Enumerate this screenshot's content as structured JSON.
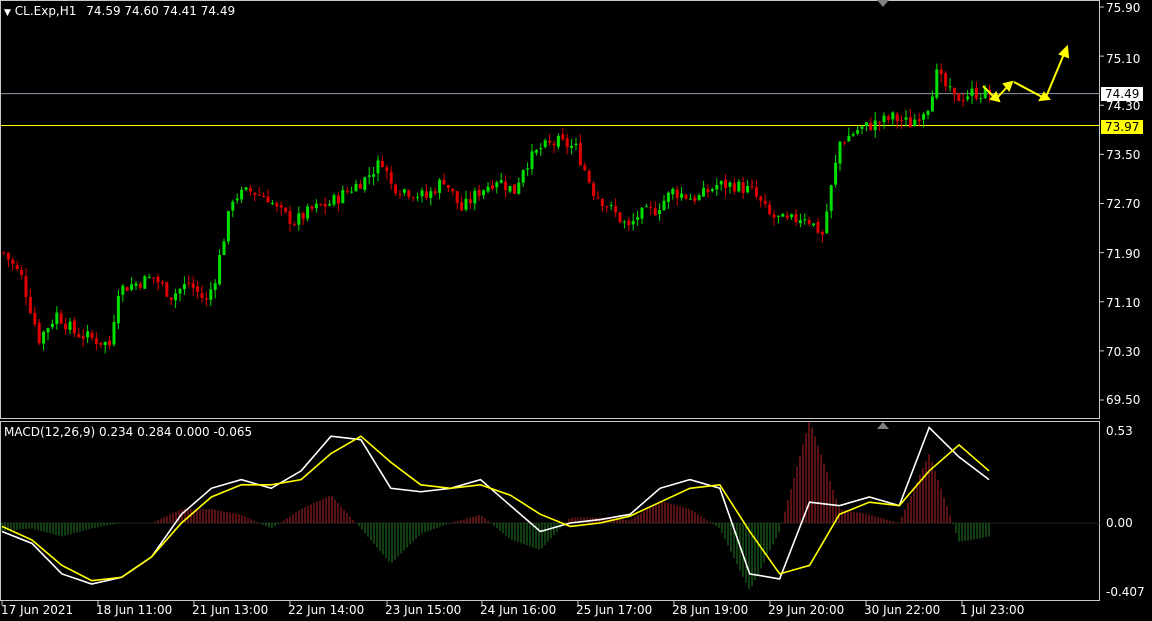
{
  "header": {
    "arrow_glyph": "▼",
    "symbol_timeframe": "CL.Exp,H1",
    "ohlc": "74.59 74.60 74.41 74.49"
  },
  "price_axis": {
    "ticks": [
      "75.90",
      "75.10",
      "74.30",
      "73.50",
      "72.70",
      "71.90",
      "71.10",
      "70.30",
      "69.50"
    ],
    "bid_label": "74.49",
    "level_label": "73.97"
  },
  "macd_panel": {
    "title": "MACD(12,26,9) 0.234 0.284 0.000 -0.065",
    "ticks": [
      "0.53",
      "0.00",
      "-0.407"
    ]
  },
  "time_axis": {
    "labels": [
      "17 Jun 2021",
      "18 Jun 11:00",
      "21 Jun 13:00",
      "22 Jun 14:00",
      "23 Jun 15:00",
      "24 Jun 16:00",
      "25 Jun 17:00",
      "28 Jun 19:00",
      "29 Jun 20:00",
      "30 Jun 22:00",
      "1 Jul 23:00"
    ]
  },
  "colors": {
    "background": "#000000",
    "bull_candle": "#00e000",
    "bear_candle": "#e00000",
    "horizontal_level": "#ffff00",
    "bid_line": "#8a9aa8",
    "macd_line": "#ffffff",
    "signal_line": "#ffff00",
    "histogram_up": "#b22222",
    "histogram_down": "#1e7d1e",
    "arrows": "#ffff00"
  },
  "chart_data": [
    {
      "type": "candlestick",
      "title": "CL.Exp,H1",
      "ylim": [
        69.3,
        75.95
      ],
      "x_labels": [
        "17 Jun 2021",
        "18 Jun 11:00",
        "21 Jun 13:00",
        "22 Jun 14:00",
        "23 Jun 15:00",
        "24 Jun 16:00",
        "25 Jun 17:00",
        "28 Jun 19:00",
        "29 Jun 20:00",
        "30 Jun 22:00",
        "1 Jul 23:00"
      ],
      "close_path": [
        [
          0,
          71.9
        ],
        [
          4,
          71.5
        ],
        [
          8,
          70.5
        ],
        [
          12,
          70.9
        ],
        [
          16,
          70.6
        ],
        [
          20,
          70.5
        ],
        [
          24,
          70.4
        ],
        [
          26,
          71.3
        ],
        [
          30,
          71.4
        ],
        [
          34,
          71.5
        ],
        [
          38,
          71.2
        ],
        [
          42,
          71.4
        ],
        [
          46,
          71.1
        ],
        [
          48,
          71.5
        ],
        [
          52,
          72.8
        ],
        [
          56,
          72.9
        ],
        [
          60,
          72.8
        ],
        [
          62,
          72.6
        ],
        [
          66,
          72.4
        ],
        [
          70,
          72.6
        ],
        [
          74,
          72.7
        ],
        [
          78,
          72.9
        ],
        [
          82,
          73.1
        ],
        [
          86,
          73.4
        ],
        [
          88,
          73.0
        ],
        [
          92,
          72.9
        ],
        [
          96,
          72.8
        ],
        [
          100,
          73.1
        ],
        [
          104,
          72.6
        ],
        [
          108,
          72.9
        ],
        [
          112,
          73.1
        ],
        [
          116,
          72.9
        ],
        [
          118,
          73.3
        ],
        [
          122,
          73.6
        ],
        [
          126,
          73.7
        ],
        [
          130,
          73.6
        ],
        [
          134,
          72.9
        ],
        [
          138,
          72.6
        ],
        [
          142,
          72.3
        ],
        [
          144,
          72.5
        ],
        [
          148,
          72.6
        ],
        [
          152,
          72.9
        ],
        [
          156,
          72.8
        ],
        [
          158,
          72.8
        ],
        [
          162,
          73.0
        ],
        [
          166,
          73.0
        ],
        [
          170,
          72.9
        ],
        [
          174,
          72.5
        ],
        [
          178,
          72.4
        ],
        [
          182,
          72.5
        ],
        [
          186,
          72.2
        ],
        [
          190,
          73.7
        ],
        [
          194,
          73.9
        ],
        [
          198,
          74.0
        ],
        [
          202,
          74.1
        ],
        [
          206,
          74.0
        ],
        [
          210,
          74.3
        ],
        [
          212,
          74.8
        ],
        [
          216,
          74.4
        ],
        [
          220,
          74.5
        ],
        [
          224,
          74.49
        ]
      ],
      "levels": [
        74.49,
        73.97
      ],
      "annotations": [
        "yellow projection arrows after last candle"
      ]
    },
    {
      "type": "line",
      "title": "MACD(12,26,9) 0.234 0.284 0.000 -0.065",
      "ylim": [
        -0.41,
        0.54
      ],
      "series": [
        {
          "name": "MACD",
          "values": [
            -0.05,
            -0.12,
            -0.3,
            -0.36,
            -0.32,
            -0.2,
            0.05,
            0.2,
            0.25,
            0.2,
            0.3,
            0.5,
            0.48,
            0.2,
            0.18,
            0.2,
            0.25,
            0.1,
            -0.05,
            0.0,
            0.02,
            0.05,
            0.2,
            0.25,
            0.2,
            -0.3,
            -0.33,
            0.12,
            0.1,
            0.15,
            0.1,
            0.55,
            0.38,
            0.25
          ]
        },
        {
          "name": "Signal",
          "values": [
            -0.02,
            -0.1,
            -0.25,
            -0.34,
            -0.32,
            -0.2,
            0.0,
            0.15,
            0.22,
            0.22,
            0.25,
            0.4,
            0.5,
            0.35,
            0.22,
            0.2,
            0.22,
            0.16,
            0.05,
            -0.02,
            0.0,
            0.04,
            0.12,
            0.2,
            0.22,
            -0.05,
            -0.3,
            -0.25,
            0.05,
            0.12,
            0.1,
            0.3,
            0.45,
            0.3
          ]
        }
      ],
      "histogram_ticks": [
        -0.3,
        0.2,
        0.15,
        0.1,
        0.0
      ]
    }
  ]
}
